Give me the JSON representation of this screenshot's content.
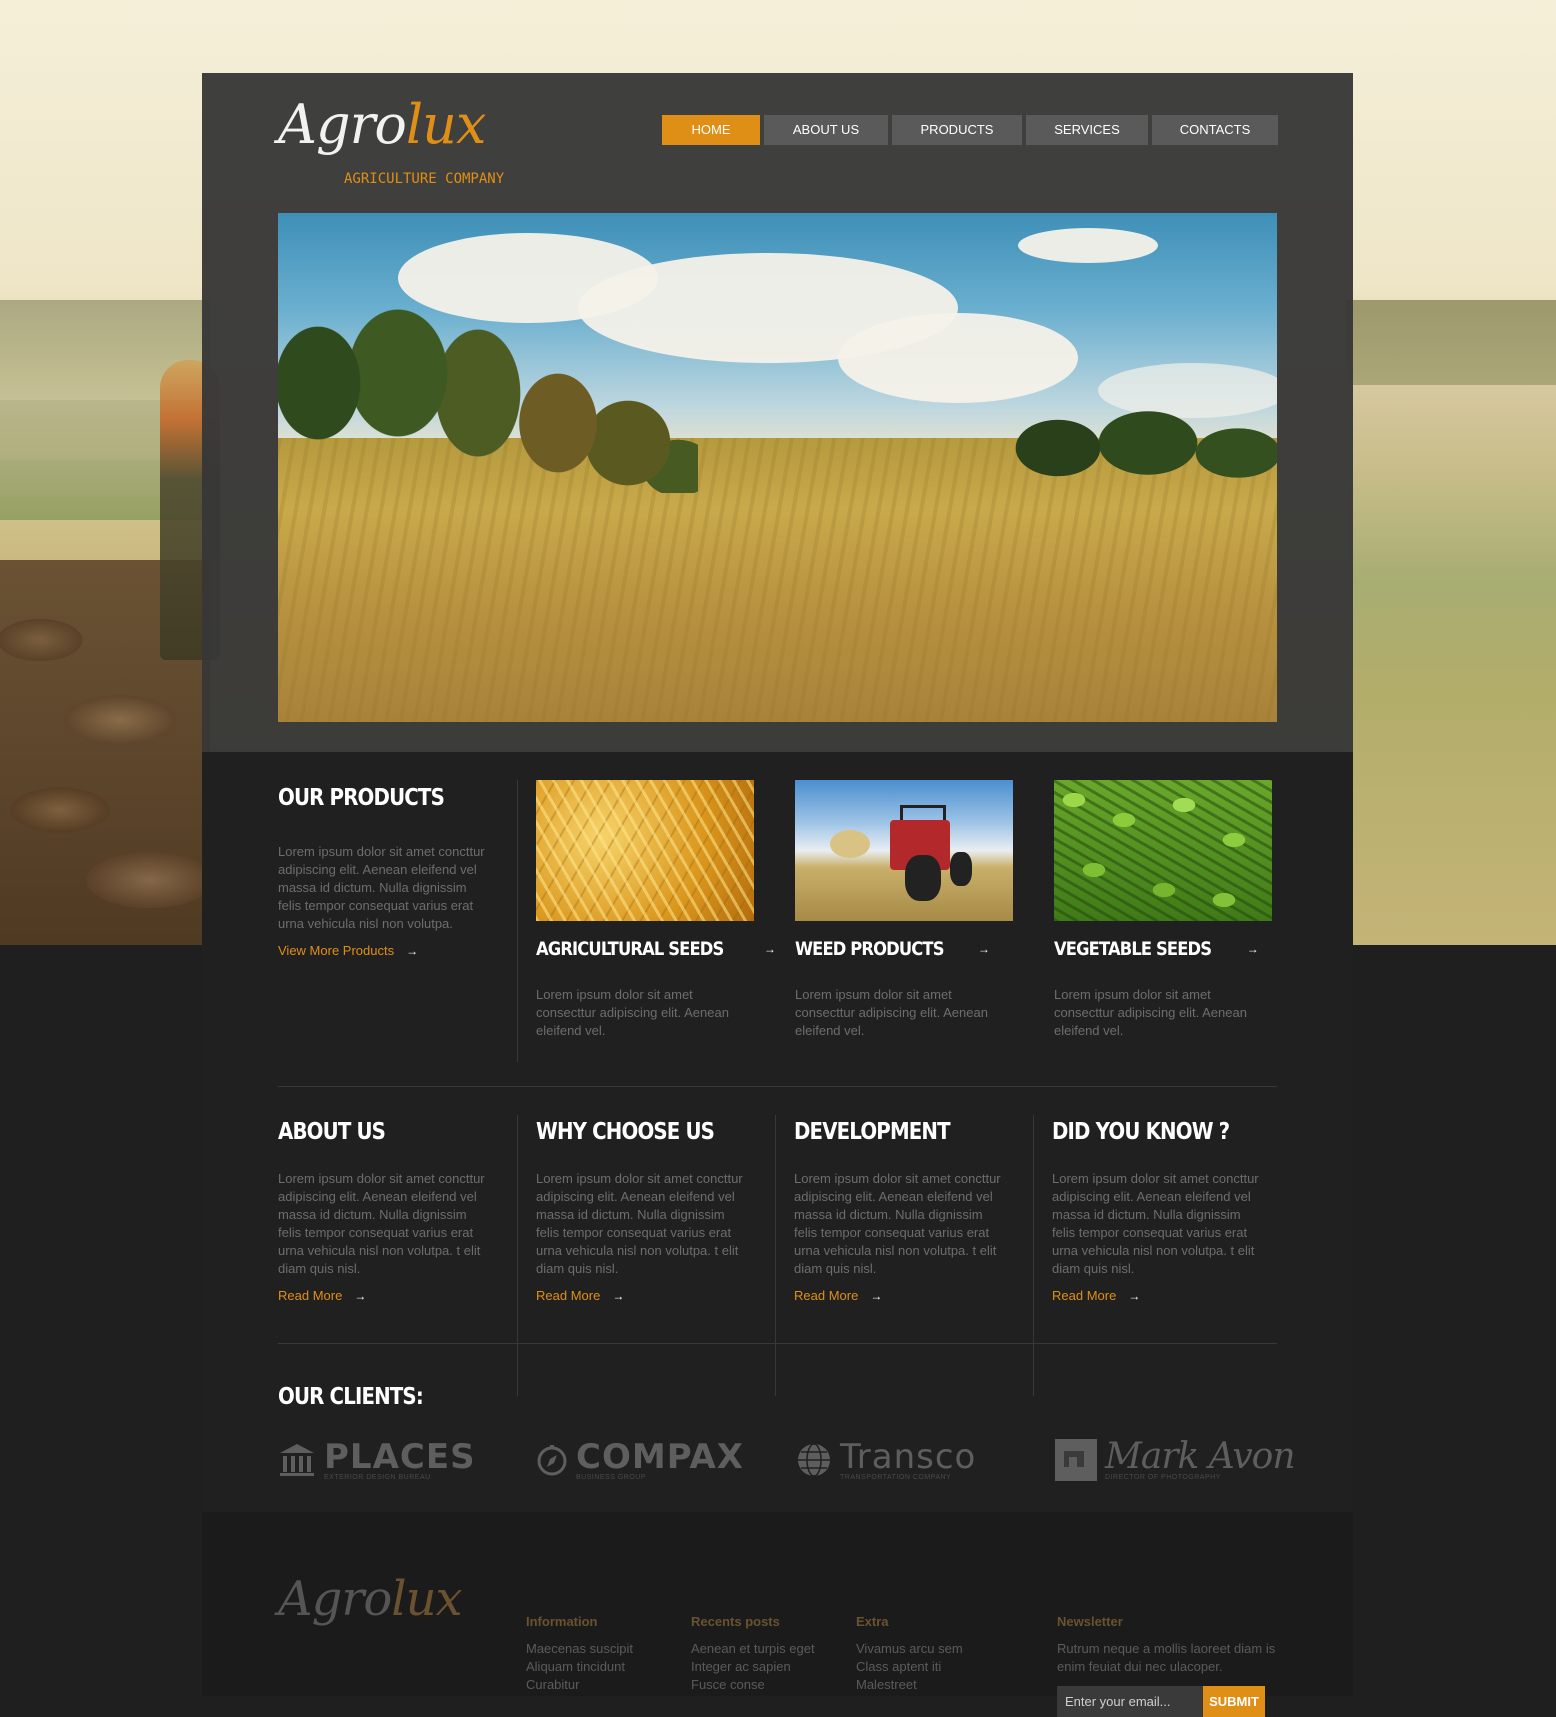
{
  "brand": {
    "logo_part1": "Agro",
    "logo_part2": "lux",
    "tagline": "AGRICULTURE COMPANY",
    "accent_color": "#e08f16"
  },
  "nav": {
    "items": [
      {
        "label": "HOME",
        "active": true
      },
      {
        "label": "ABOUT US",
        "active": false
      },
      {
        "label": "PRODUCTS",
        "active": false
      },
      {
        "label": "SERVICES",
        "active": false
      },
      {
        "label": "CONTACTS",
        "active": false
      }
    ]
  },
  "products": {
    "title": "OUR PRODUCTS",
    "intro": "Lorem ipsum dolor sit amet concttur adipiscing elit. Aenean eleifend vel massa id dictum. Nulla dignissim felis tempor consequat varius erat urna vehicula nisl non volutpa.",
    "link": "View More Products",
    "items": [
      {
        "name": "AGRICULTURAL SEEDS",
        "desc": "Lorem ipsum dolor sit amet consecttur adipiscing elit. Aenean eleifend vel."
      },
      {
        "name": "WEED PRODUCTS",
        "desc": "Lorem ipsum dolor sit amet consecttur adipiscing elit. Aenean eleifend vel."
      },
      {
        "name": "VEGETABLE SEEDS",
        "desc": "Lorem ipsum dolor sit amet consecttur adipiscing elit. Aenean eleifend vel."
      }
    ]
  },
  "info": [
    {
      "title": "ABOUT US",
      "text": "Lorem ipsum dolor sit amet concttur adipiscing elit. Aenean eleifend vel massa id dictum. Nulla dignissim felis tempor consequat varius erat urna vehicula nisl non volutpa. t elit diam quis nisl.",
      "link": "Read More"
    },
    {
      "title": "WHY CHOOSE US",
      "text": "Lorem ipsum dolor sit amet concttur adipiscing elit. Aenean eleifend vel massa id dictum. Nulla dignissim felis tempor consequat varius erat urna vehicula nisl non volutpa. t elit diam quis nisl.",
      "link": "Read More"
    },
    {
      "title": "DEVELOPMENT",
      "text": "Lorem ipsum dolor sit amet concttur adipiscing elit. Aenean eleifend vel massa id dictum. Nulla dignissim felis tempor consequat varius erat urna vehicula nisl non volutpa. t elit diam quis nisl.",
      "link": "Read More"
    },
    {
      "title": "DID YOU KNOW ?",
      "text": "Lorem ipsum dolor sit amet concttur adipiscing elit. Aenean eleifend vel massa id dictum. Nulla dignissim felis tempor consequat varius erat urna vehicula nisl non volutpa. t elit diam quis nisl.",
      "link": "Read More"
    }
  ],
  "clients": {
    "title": "OUR CLIENTS:",
    "items": [
      {
        "name": "PLACES",
        "sub": "EXTERIOR DESIGN BUREAU",
        "icon": "building-icon"
      },
      {
        "name": "COMPAX",
        "sub": "BUSINESS GROUP",
        "icon": "compass-icon"
      },
      {
        "name": "Transco",
        "sub": "TRANSPORTATION COMPANY",
        "icon": "globe-icon"
      },
      {
        "name": "Mark Avon",
        "sub": "DIRECTOR OF PHOTOGRAPHY",
        "icon": "square-logo-icon"
      }
    ]
  },
  "footer": {
    "columns": [
      {
        "title": "Information",
        "links": [
          "Maecenas suscipit",
          "Aliquam tincidunt",
          "Curabitur"
        ]
      },
      {
        "title": "Recents posts",
        "links": [
          "Aenean et turpis eget",
          "Integer ac sapien",
          "Fusce conse"
        ]
      },
      {
        "title": "Extra",
        "links": [
          "Vivamus arcu sem",
          "Class aptent iti",
          "Malestreet"
        ]
      }
    ],
    "newsletter": {
      "title": "Newsletter",
      "text": "Rutrum neque a mollis laoreet diam is enim feuiat dui nec ulacoper.",
      "placeholder": "Enter your email...",
      "button": "SUBMIT"
    }
  }
}
